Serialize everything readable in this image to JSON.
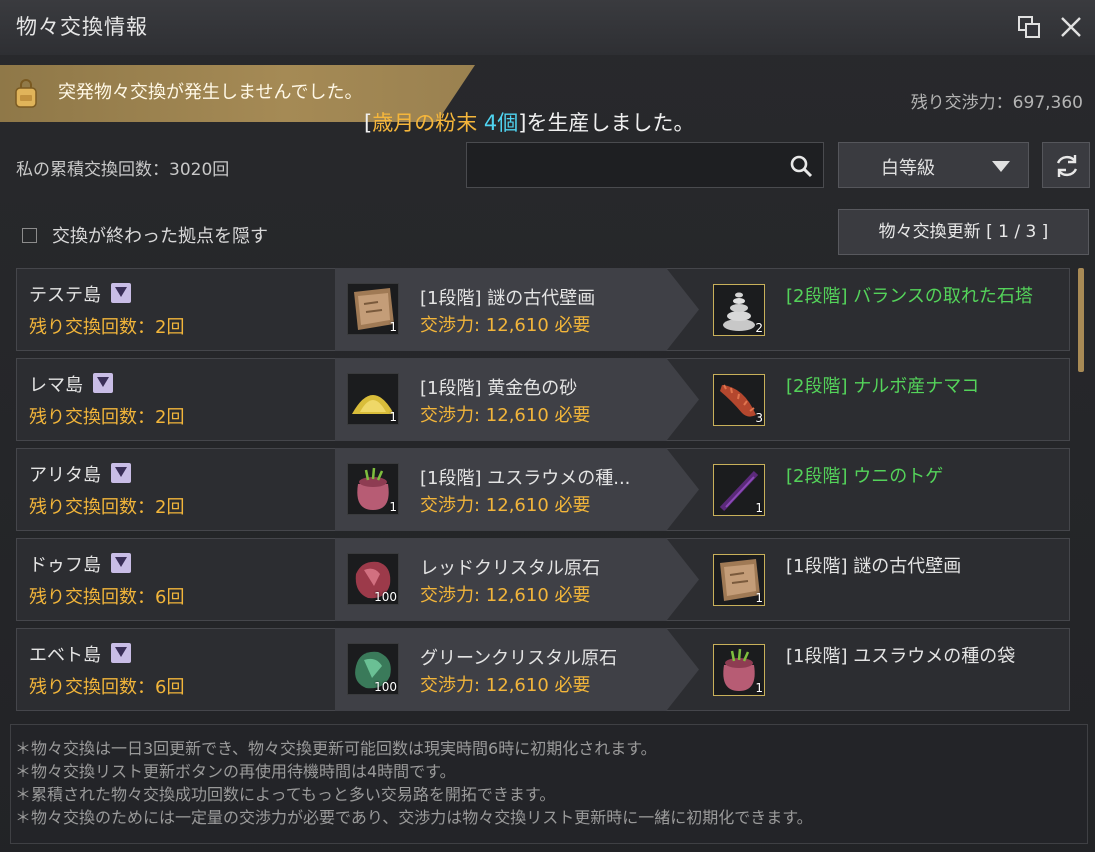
{
  "window": {
    "title": "物々交換情報"
  },
  "banner": {
    "text": "突発物々交換が発生しませんでした。"
  },
  "power": {
    "text": "残り交渉力：697,360"
  },
  "produced": {
    "open": "[",
    "item": "歳月の粉末",
    "count": "4個",
    "close": "]を生産しました。"
  },
  "accumulated": {
    "text": "私の累積交換回数：3020回"
  },
  "search": {
    "placeholder": ""
  },
  "grade_filter": {
    "value": "白等級"
  },
  "hide_finished": {
    "label": "交換が終わった拠点を隠す",
    "checked": false
  },
  "update_button": {
    "label": "物々交換更新 [ 1 / 3 ]"
  },
  "rows": [
    {
      "island": "テステ島",
      "remain": "残り交換回数：2回",
      "give_name": "[1段階] 謎の古代壁画",
      "give_cost": "交渉力: 12,610 必要",
      "give_qty": "1",
      "give_icon": "ancient-mural-icon",
      "get_name": "[2段階] バランスの取れた石塔",
      "get_qty": "2",
      "get_icon": "stone-tower-icon",
      "get_color": "#54d35a"
    },
    {
      "island": "レマ島",
      "remain": "残り交換回数：2回",
      "give_name": "[1段階] 黄金色の砂",
      "give_cost": "交渉力: 12,610 必要",
      "give_qty": "1",
      "give_icon": "golden-sand-icon",
      "get_name": "[2段階] ナルボ産ナマコ",
      "get_qty": "3",
      "get_icon": "sea-cucumber-icon",
      "get_color": "#54d35a"
    },
    {
      "island": "アリタ島",
      "remain": "残り交換回数：2回",
      "give_name": "[1段階] ユスラウメの種...",
      "give_cost": "交渉力: 12,610 必要",
      "give_qty": "1",
      "give_icon": "seed-bag-icon",
      "get_name": "[2段階] ウニのトゲ",
      "get_qty": "1",
      "get_icon": "urchin-spine-icon",
      "get_color": "#54d35a"
    },
    {
      "island": "ドゥフ島",
      "remain": "残り交換回数：6回",
      "give_name": "レッドクリスタル原石",
      "give_cost": "交渉力: 12,610 必要",
      "give_qty": "100",
      "give_icon": "red-crystal-icon",
      "get_name": "[1段階] 謎の古代壁画",
      "get_qty": "1",
      "get_icon": "ancient-mural-icon",
      "get_color": "#e4e4e4"
    },
    {
      "island": "エベト島",
      "remain": "残り交換回数：6回",
      "give_name": "グリーンクリスタル原石",
      "give_cost": "交渉力: 12,610 必要",
      "give_qty": "100",
      "give_icon": "green-crystal-icon",
      "get_name": "[1段階] ユスラウメの種の袋",
      "get_qty": "1",
      "get_icon": "seed-bag-icon",
      "get_color": "#e4e4e4"
    }
  ],
  "notes": [
    "＊物々交換は一日3回更新でき、物々交換更新可能回数は現実時間6時に初期化されます。",
    "＊物々交換リスト更新ボタンの再使用待機時間は4時間です。",
    "＊累積された物々交換成功回数によってもっと多い交易路を開拓できます。",
    "＊物々交換のためには一定量の交渉力が必要であり、交渉力は物々交換リスト更新時に一緒に初期化できます。"
  ]
}
